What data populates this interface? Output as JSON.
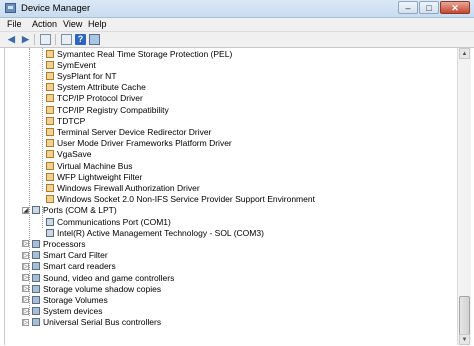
{
  "window": {
    "title": "Device Manager",
    "buttons": {
      "minimize": "–",
      "maximize": "□",
      "close": "✕"
    }
  },
  "menubar": [
    "File",
    "Action",
    "View",
    "Help"
  ],
  "toolbar": {
    "back_icon": "back-arrow-icon",
    "forward_icon": "forward-arrow-icon",
    "glyphs": {
      "back": "◀",
      "forward": "▶",
      "help": "?"
    }
  },
  "tree": {
    "drivers": [
      "Symantec Real Time Storage Protection (PEL)",
      "SymEvent",
      "SysPlant for NT",
      "System Attribute Cache",
      "TCP/IP Protocol Driver",
      "TCP/IP Registry Compatibility",
      "TDTCP",
      "Terminal Server Device Redirector Driver",
      "User Mode Driver Frameworks Platform Driver",
      "VgaSave",
      "Virtual Machine Bus",
      "WFP Lightweight Filter",
      "Windows Firewall Authorization Driver",
      "Windows Socket 2.0 Non-IFS Service Provider Support Environment"
    ],
    "ports": {
      "label": "Ports (COM & LPT)",
      "children": [
        "Communications Port (COM1)",
        "Intel(R) Active Management Technology - SOL (COM3)"
      ]
    },
    "categories": [
      "Processors",
      "Smart Card Filter",
      "Smart card readers",
      "Sound, video and game controllers",
      "Storage volume shadow copies",
      "Storage Volumes",
      "System devices",
      "Universal Serial Bus controllers"
    ],
    "expander_collapsed": "▷",
    "expander_expanded": "◢"
  },
  "scrollbar": {
    "up": "▲",
    "down": "▼"
  },
  "colors": {
    "title_bar": "#c9dcf0",
    "close_button": "#c4462f",
    "tree_background": "#ffffff"
  }
}
